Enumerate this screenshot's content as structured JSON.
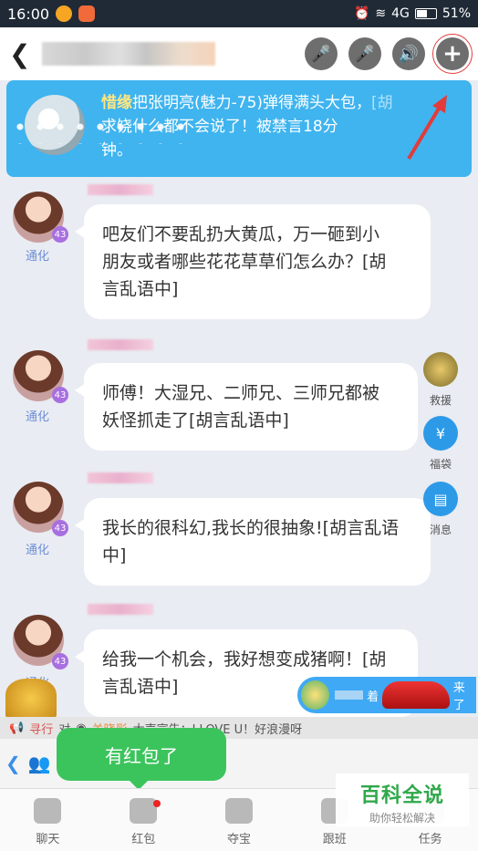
{
  "status_bar": {
    "time": "16:00",
    "network": "4G",
    "battery": "51%"
  },
  "header": {
    "back_icon": "back-arrow-icon",
    "actions": [
      "mic-icon",
      "mic-icon",
      "speaker-icon",
      "plus-icon"
    ]
  },
  "announcement": {
    "nick": "惜缘",
    "line1": "把张明亮(魅力-75)弹得满头大包，",
    "line2": "求饶什么都不会说了！被禁言18分",
    "line3": "钟。",
    "suffix": "[胡"
  },
  "messages": [
    {
      "role": "通化",
      "level": "43",
      "text1": "吧友们不要乱扔大黄瓜，万一砸到小",
      "text2": "朋友或者哪些花花草草们怎么办？[胡",
      "text3": "言乱语中]"
    },
    {
      "role": "通化",
      "level": "43",
      "text1": "师傅！大湿兄、二师兄、三师兄都被",
      "text2": "妖怪抓走了[胡言乱语中]"
    },
    {
      "role": "通化",
      "level": "43",
      "text1": "我长的很科幻,我长的很抽象![胡言乱语",
      "text2": "中]"
    },
    {
      "role": "通化",
      "level": "43",
      "text1": "给我一个机会，我好想变成猪啊！[胡",
      "text2": "言乱语中]"
    }
  ],
  "side_widgets": {
    "rescue": "救援",
    "lucky_bag": "福袋",
    "message": "消息"
  },
  "car_banner": {
    "prefix": "着",
    "suffix": "来了"
  },
  "marquee": {
    "user1": "寻行",
    "verb": "对",
    "user2": "关晓彤",
    "text": "大声宣告：I LOVE U！好浪漫呀"
  },
  "toast": "有红包了",
  "tabs": [
    "聊天",
    "红包",
    "夺宝",
    "跟班",
    "任务"
  ],
  "watermark": {
    "title": "百科全说",
    "subtitle": "助你轻松解决"
  }
}
